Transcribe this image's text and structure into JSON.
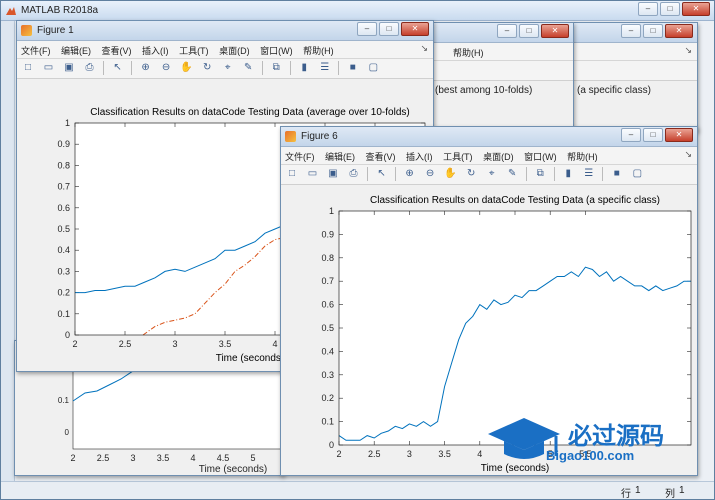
{
  "app": {
    "title": "MATLAB R2018a"
  },
  "menus": {
    "items": [
      "文件(F)",
      "编辑(E)",
      "查看(V)",
      "插入(I)",
      "工具(T)",
      "桌面(D)",
      "窗口(W)",
      "帮助(H)"
    ],
    "partial_help": "帮助(H)"
  },
  "toolbar_icons": [
    "new-file-icon",
    "open-icon",
    "save-icon",
    "print-icon",
    "pointer-icon",
    "zoom-in-icon",
    "zoom-out-icon",
    "pan-icon",
    "rotate-icon",
    "data-cursor-icon",
    "brush-icon",
    "colorbar-icon",
    "legend-icon",
    "hide-plot-icon",
    "show-plot-icon"
  ],
  "figure1": {
    "title": "Figure 1",
    "chart_title": "Classification Results on dataCode Testing Data (average over 10-folds)"
  },
  "figure6": {
    "title": "Figure 6",
    "chart_title": "Classification Results on dataCode Testing Data (a specific class)"
  },
  "behind": {
    "chart_title_a": "(best among 10-folds)",
    "chart_title_b": "(a specific class)",
    "xlabel": "Time (seconds)"
  },
  "status": {
    "row_label": "行",
    "row_value": "1",
    "col_label": "列",
    "col_value": "1"
  },
  "watermark": {
    "main": "必过源码",
    "sub": "Bigao100.com"
  },
  "colors": {
    "series_blue": "#0072bd",
    "series_orange": "#d95319"
  },
  "chart_data": [
    {
      "type": "line",
      "title": "Classification Results on dataCode Testing Data (average over 10-folds)",
      "xlabel": "Time (seconds)",
      "xlim": [
        2,
        5.5
      ],
      "ylim": [
        0,
        1
      ],
      "xticks": [
        "2",
        "2.5",
        "3",
        "3.5",
        "4",
        "4.5",
        "5"
      ],
      "yticks": [
        "0",
        "0.1",
        "0.2",
        "0.3",
        "0.4",
        "0.5",
        "0.6",
        "0.7",
        "0.8",
        "0.9",
        "1"
      ],
      "series": [
        {
          "color": "#0072bd",
          "dash": "solid",
          "x": [
            2.0,
            2.1,
            2.2,
            2.3,
            2.4,
            2.5,
            2.6,
            2.7,
            2.8,
            2.9,
            3.0,
            3.1,
            3.2,
            3.3,
            3.4,
            3.5,
            3.6,
            3.7,
            3.8,
            3.9,
            4.0,
            4.1,
            4.2,
            4.3,
            4.4,
            4.5,
            4.6,
            4.7,
            4.8,
            4.9,
            5.0,
            5.1,
            5.2,
            5.3,
            5.4,
            5.5
          ],
          "y": [
            0.2,
            0.2,
            0.21,
            0.21,
            0.22,
            0.23,
            0.23,
            0.25,
            0.27,
            0.3,
            0.31,
            0.3,
            0.32,
            0.34,
            0.36,
            0.4,
            0.4,
            0.42,
            0.44,
            0.48,
            0.5,
            0.52,
            0.54,
            0.55,
            0.57,
            0.58,
            0.6,
            0.61,
            0.62,
            0.62,
            0.64,
            0.66,
            0.67,
            0.68,
            0.7,
            0.71
          ]
        },
        {
          "color": "#d95319",
          "dash": "dashdot",
          "x": [
            2.68,
            2.8,
            2.9,
            3.0,
            3.1,
            3.2,
            3.3,
            3.4,
            3.5,
            3.6,
            3.7,
            3.8,
            3.9,
            4.0,
            4.1,
            4.2,
            4.3,
            4.4,
            4.5,
            4.6,
            4.7,
            4.8,
            4.9,
            5.0,
            5.1,
            5.2,
            5.3,
            5.4,
            5.5
          ],
          "y": [
            0.0,
            0.04,
            0.06,
            0.07,
            0.08,
            0.1,
            0.15,
            0.2,
            0.24,
            0.3,
            0.33,
            0.37,
            0.42,
            0.45,
            0.46,
            0.47,
            0.49,
            0.5,
            0.51,
            0.53,
            0.54,
            0.55,
            0.56,
            0.58,
            0.6,
            0.62,
            0.64,
            0.66,
            0.68
          ]
        }
      ]
    },
    {
      "type": "line",
      "title": "Classification Results on dataCode Testing Data (a specific class)",
      "xlabel": "Time (seconds)",
      "xlim": [
        2,
        7
      ],
      "ylim": [
        0,
        1
      ],
      "xticks": [
        "2",
        "2.5",
        "3",
        "3.5",
        "4",
        "4.5",
        "5",
        "5.5"
      ],
      "yticks": [
        "0",
        "0.1",
        "0.2",
        "0.3",
        "0.4",
        "0.5",
        "0.6",
        "0.7",
        "0.8",
        "0.9",
        "1"
      ],
      "series": [
        {
          "color": "#0072bd",
          "dash": "solid",
          "x": [
            2.0,
            2.1,
            2.2,
            2.3,
            2.4,
            2.5,
            2.6,
            2.7,
            2.8,
            2.9,
            3.0,
            3.1,
            3.2,
            3.3,
            3.4,
            3.5,
            3.6,
            3.7,
            3.8,
            3.9,
            4.0,
            4.1,
            4.2,
            4.3,
            4.4,
            4.5,
            4.6,
            4.7,
            4.8,
            4.9,
            5.0,
            5.1,
            5.2,
            5.3,
            5.4,
            5.5,
            5.6,
            5.7,
            5.8,
            5.9,
            6.0,
            6.1,
            6.2,
            6.3,
            6.4,
            6.5,
            6.6,
            6.7,
            6.8,
            6.9,
            7.0
          ],
          "y": [
            0.04,
            0.02,
            0.02,
            0.02,
            0.04,
            0.03,
            0.05,
            0.06,
            0.08,
            0.07,
            0.09,
            0.08,
            0.1,
            0.08,
            0.1,
            0.25,
            0.35,
            0.45,
            0.52,
            0.55,
            0.6,
            0.58,
            0.62,
            0.6,
            0.61,
            0.64,
            0.63,
            0.66,
            0.66,
            0.68,
            0.7,
            0.72,
            0.72,
            0.74,
            0.72,
            0.76,
            0.75,
            0.72,
            0.74,
            0.7,
            0.72,
            0.7,
            0.68,
            0.68,
            0.66,
            0.68,
            0.66,
            0.67,
            0.68,
            0.7,
            0.7
          ]
        }
      ]
    }
  ]
}
